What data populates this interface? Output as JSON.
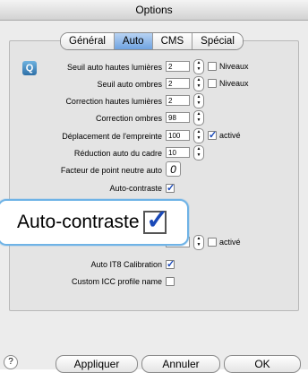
{
  "window": {
    "title": "Options"
  },
  "tabs": [
    {
      "label": "Général",
      "active": false
    },
    {
      "label": "Auto",
      "active": true
    },
    {
      "label": "CMS",
      "active": false
    },
    {
      "label": "Spécial",
      "active": false
    }
  ],
  "rows": {
    "seuil_hautes": {
      "label": "Seuil auto hautes lumières",
      "value": "2",
      "check_label": "Niveaux",
      "checked": false
    },
    "seuil_ombres": {
      "label": "Seuil auto ombres",
      "value": "2",
      "check_label": "Niveaux",
      "checked": false
    },
    "corr_hautes": {
      "label": "Correction hautes lumières",
      "value": "2"
    },
    "corr_ombres": {
      "label": "Correction ombres",
      "value": "98"
    },
    "deplacement": {
      "label": "Déplacement de l'empreinte",
      "value": "100",
      "check_label": "activé",
      "checked": true
    },
    "reduction": {
      "label": "Réduction auto du cadre",
      "value": "10"
    },
    "facteur": {
      "label": "Facteur de point neutre auto",
      "value": "0"
    },
    "autocontraste": {
      "label": "Auto-contraste",
      "checked": true
    },
    "partial_row": {
      "label": "...",
      "check_label": "activé",
      "checked": false
    },
    "it8": {
      "label": "Auto IT8 Calibration",
      "checked": true
    },
    "icc": {
      "label": "Custom ICC profile name",
      "checked": false
    }
  },
  "callout": {
    "label": "Auto-contraste",
    "checked": true
  },
  "buttons": {
    "help": "?",
    "apply": "Appliquer",
    "cancel": "Annuler",
    "ok": "OK"
  },
  "colors": {
    "active_tab": "#6fa3e1",
    "callout_border": "#6fb3e6",
    "check": "#1a49b8"
  }
}
